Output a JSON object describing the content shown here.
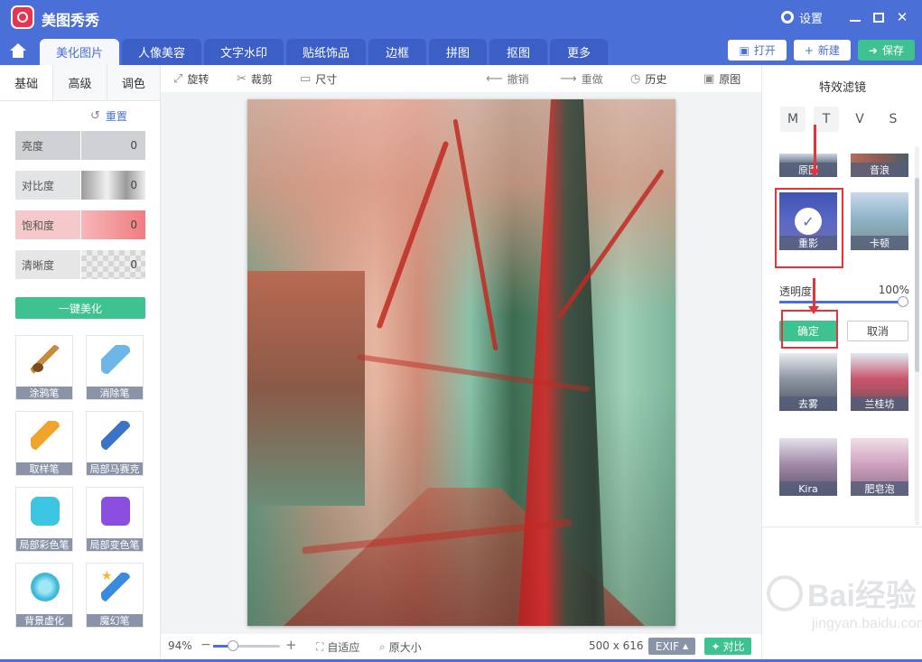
{
  "app": {
    "title": "美图秀秀",
    "settings_label": "设置"
  },
  "nav": {
    "tabs": [
      "美化图片",
      "人像美容",
      "文字水印",
      "贴纸饰品",
      "边框",
      "拼图",
      "抠图",
      "更多"
    ],
    "open_label": "打开",
    "new_label": "新建",
    "save_label": "保存"
  },
  "left": {
    "subtabs": [
      "基础",
      "高级",
      "调色"
    ],
    "reset_label": "重置",
    "sliders": [
      {
        "label": "亮度",
        "value": "0"
      },
      {
        "label": "对比度",
        "value": "0"
      },
      {
        "label": "饱和度",
        "value": "0"
      },
      {
        "label": "清晰度",
        "value": "0"
      }
    ],
    "onekey_label": "一键美化",
    "tools": [
      "涂鸦笔",
      "消除笔",
      "取样笔",
      "局部马赛克",
      "局部彩色笔",
      "局部变色笔",
      "背景虚化",
      "魔幻笔"
    ]
  },
  "toolbar": {
    "rotate": "旋转",
    "crop": "裁剪",
    "size": "尺寸",
    "undo": "撤销",
    "redo": "重做",
    "history": "历史",
    "original": "原图"
  },
  "status": {
    "zoom": "94%",
    "zoom_level": 0.3,
    "fit_label": "自适应",
    "actual_label": "原大小",
    "dimensions": "500 x 616",
    "exif_label": "EXIF",
    "compare_label": "对比"
  },
  "right": {
    "title": "特效滤镜",
    "categories": [
      "M",
      "T",
      "V",
      "S"
    ],
    "filters": {
      "orig": "原图",
      "sound": "音浪",
      "ghost": "重影",
      "cartoon": "卡顿",
      "fog": "去雾",
      "lgf": "兰桂坊",
      "kira": "Kira",
      "soap": "肥皂泡"
    },
    "opacity_label": "透明度",
    "opacity_value": "100%",
    "ok_label": "确定",
    "cancel_label": "取消"
  },
  "watermark": {
    "brand": "Bai经验",
    "site": "jingyan.baidu.com"
  },
  "colors": {
    "brand": "#4a6fd6",
    "accent_green": "#3ec28f",
    "highlight_red": "#e2343a"
  }
}
